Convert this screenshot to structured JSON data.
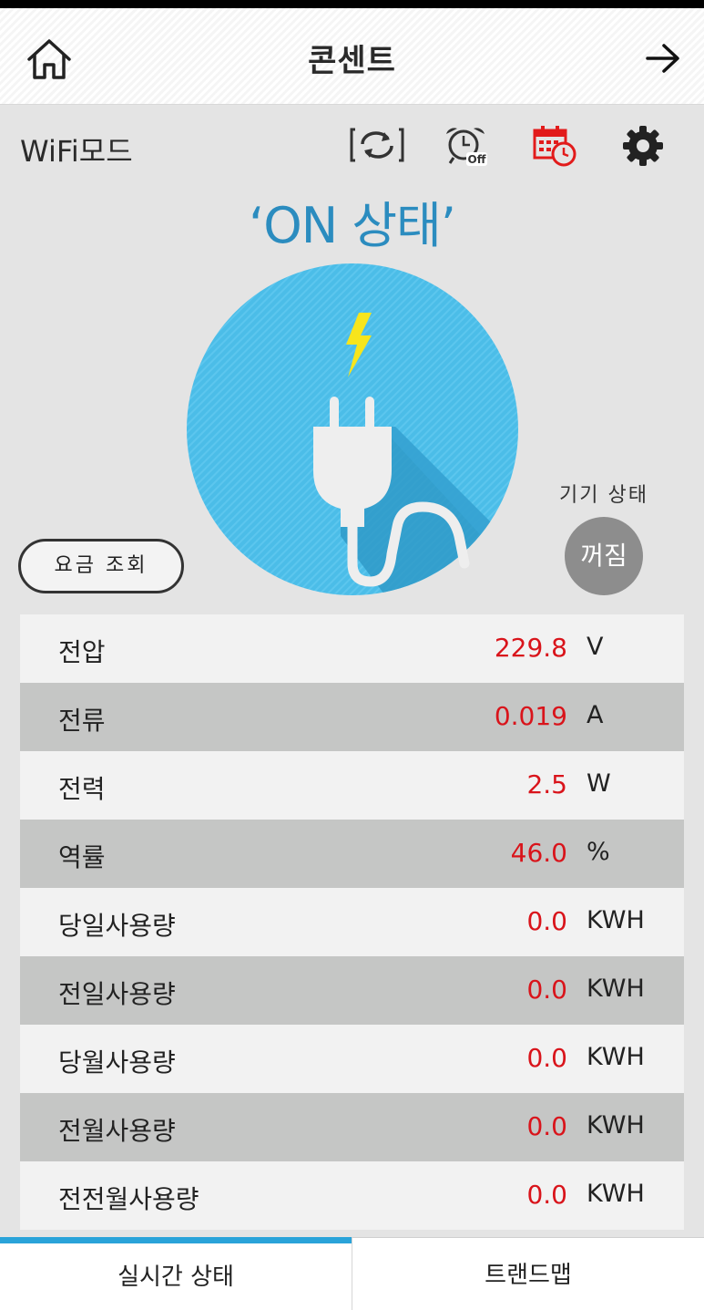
{
  "header": {
    "title": "콘센트",
    "home_icon": "home-icon",
    "next_icon": "arrow-right-icon"
  },
  "toolbar": {
    "mode_label": "WiFi모드",
    "icons": [
      "sync-icon",
      "alarm-off-icon",
      "schedule-icon",
      "gear-icon"
    ],
    "schedule_color": "#e21b1b"
  },
  "status": {
    "text": "‘ON 상태’",
    "color": "#2b8cbf"
  },
  "plug": {
    "icon": "plug-icon",
    "circle_color": "#4bbde8",
    "bolt_color": "#f7e51c"
  },
  "fee_button": {
    "label": "요금 조회"
  },
  "device": {
    "label": "기기 상태",
    "button": "꺼짐"
  },
  "measurements": [
    {
      "label": "전압",
      "value": "229.8",
      "unit": "V"
    },
    {
      "label": "전류",
      "value": "0.019",
      "unit": "A"
    },
    {
      "label": "전력",
      "value": "2.5",
      "unit": "W"
    },
    {
      "label": "역률",
      "value": "46.0",
      "unit": "%"
    },
    {
      "label": "당일사용량",
      "value": "0.0",
      "unit": "KWH"
    },
    {
      "label": "전일사용량",
      "value": "0.0",
      "unit": "KWH"
    },
    {
      "label": "당월사용량",
      "value": "0.0",
      "unit": "KWH"
    },
    {
      "label": "전월사용량",
      "value": "0.0",
      "unit": "KWH"
    },
    {
      "label": "전전월사용량",
      "value": "0.0",
      "unit": "KWH"
    }
  ],
  "tabs": [
    {
      "label": "실시간 상태",
      "active": true
    },
    {
      "label": "트랜드맵",
      "active": false
    }
  ],
  "colors": {
    "value_red": "#d9141b",
    "tab_active": "#2aa3d9"
  }
}
